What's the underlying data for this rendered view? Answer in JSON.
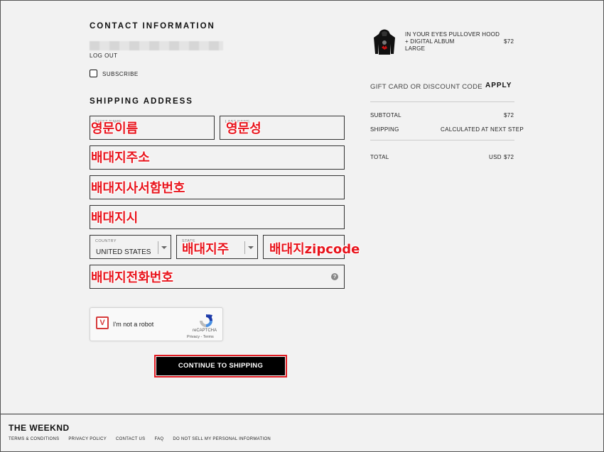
{
  "contact": {
    "title": "CONTACT INFORMATION",
    "logout": "LOG OUT",
    "subscribe": "SUBSCRIBE"
  },
  "shipping": {
    "title": "SHIPPING ADDRESS",
    "first_name_label": "FIRST NAME",
    "last_name_label": "LAST NAME",
    "country_label": "COUNTRY",
    "country_value": "UNITED STATES",
    "state_label": "STATE"
  },
  "annotations": {
    "first_name": "영문이름",
    "last_name": "영문성",
    "address": "배대지주소",
    "apartment": "배대지사서함번호",
    "city": "배대지시",
    "state": "배대지주",
    "zip": "배대지zipcode",
    "phone": "배대지전화번호"
  },
  "recaptcha": {
    "label": "I'm not a robot",
    "brand": "reCAPTCHA",
    "terms": "Privacy - Terms"
  },
  "continue_label": "CONTINUE TO SHIPPING",
  "order": {
    "product_lines": [
      "IN YOUR EYES PULLOVER HOOD",
      "+ DIGITAL ALBUM",
      "LARGE"
    ],
    "product_price": "$72",
    "gift_placeholder": "GIFT CARD OR DISCOUNT CODE",
    "apply_label": "APPLY",
    "subtotal_label": "SUBTOTAL",
    "subtotal_value": "$72",
    "shipping_label": "SHIPPING",
    "shipping_value": "CALCULATED AT NEXT STEP",
    "total_label": "TOTAL",
    "total_currency": "USD",
    "total_value": "$72"
  },
  "footer": {
    "brand": "THE WEEKND",
    "links": [
      "TERMS & CONDITIONS",
      "PRIVACY POLICY",
      "CONTACT US",
      "FAQ",
      "DO NOT SELL MY PERSONAL INFORMATION"
    ]
  },
  "colors": {
    "annotation_red": "#e8141c",
    "button_bg": "#000000",
    "page_bg": "#f2f2f2"
  }
}
